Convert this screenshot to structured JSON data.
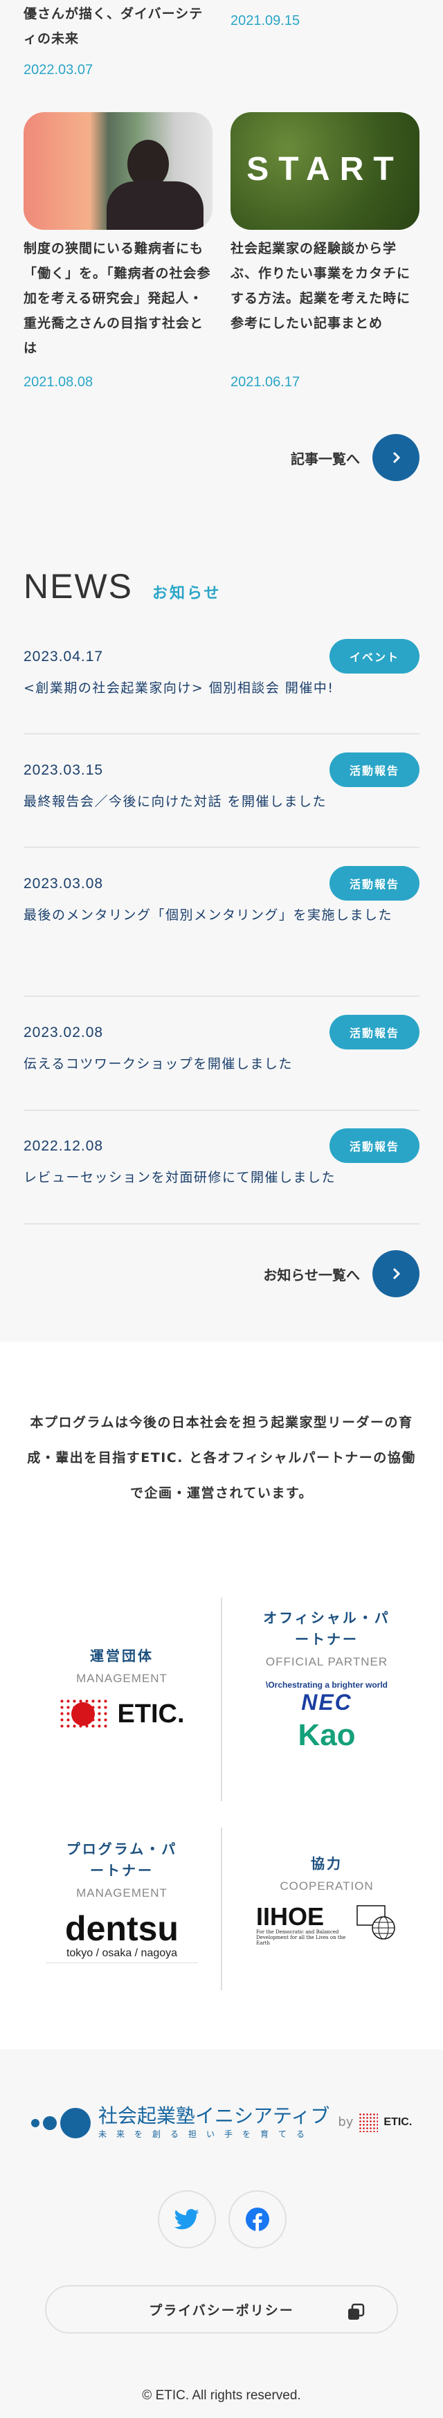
{
  "articles": [
    {
      "title": "優さんが描く、ダイバーシティの未来",
      "date": "2022.03.07"
    },
    {
      "title": "",
      "date": "2021.09.15"
    },
    {
      "title": "制度の狭間にいる難病者にも「働く」を。「難病者の社会参加を考える研究会」発起人・重光喬之さんの目指す社会とは",
      "date": "2021.08.08",
      "image": "presenter-photo"
    },
    {
      "title": "社会起業家の経験談から学ぶ、作りたい事業をカタチにする方法。起業を考えた時に参考にしたい記事まとめ",
      "date": "2021.06.17",
      "image": "start-grass-photo",
      "image_text": "START"
    }
  ],
  "articles_more": "記事一覧へ",
  "news": {
    "title": "NEWS",
    "subtitle": "お知らせ",
    "items": [
      {
        "date": "2023.04.17",
        "badge": "イベント",
        "title": "<創業期の社会起業家向け> 個別相談会 開催中!"
      },
      {
        "date": "2023.03.15",
        "badge": "活動報告",
        "title": "最終報告会／今後に向けた対話 を開催しました"
      },
      {
        "date": "2023.03.08",
        "badge": "活動報告",
        "title": "最後のメンタリング「個別メンタリング」を実施しました"
      },
      {
        "date": "2023.02.08",
        "badge": "活動報告",
        "title": "伝えるコツワークショップを開催しました"
      },
      {
        "date": "2022.12.08",
        "badge": "活動報告",
        "title": "レビューセッションを対面研修にて開催しました"
      }
    ],
    "more": "お知らせ一覧へ"
  },
  "intro": "本プログラムは今後の日本社会を担う起業家型リーダーの育成・輩出を目指すETIC. と各オフィシャルパートナーの協働で企画・運営されています。",
  "partners": [
    {
      "jp": "運営団体",
      "en": "MANAGEMENT",
      "logos": [
        "ETIC."
      ]
    },
    {
      "jp": "オフィシャル・パートナー",
      "en": "OFFICIAL PARTNER",
      "logos": [
        "\\Orchestrating a brighter world",
        "NEC",
        "Kao"
      ]
    },
    {
      "jp": "プログラム・パートナー",
      "en": "MANAGEMENT",
      "logos": [
        "dentsu",
        "tokyo / osaka / nagoya"
      ]
    },
    {
      "jp": "協力",
      "en": "COOPERATION",
      "logos": [
        "IIHOE",
        "For the Democratic and Balanced Development for all the Lives on the Earth"
      ]
    }
  ],
  "footer": {
    "logo_title": "社会起業塾イニシアティブ",
    "logo_tagline": "未来を創る担い手を育てる",
    "logo_by": "by",
    "logo_etic": "ETIC.",
    "social": [
      "twitter-icon",
      "facebook-icon"
    ],
    "privacy": "プライバシーポリシー",
    "copyright": "© ETIC. All rights reserved."
  },
  "colors": {
    "accent": "#2aa5c7",
    "navy": "#1b3f6b",
    "button": "#17659f",
    "twitter": "#1d9bf0",
    "facebook": "#1877f2"
  }
}
